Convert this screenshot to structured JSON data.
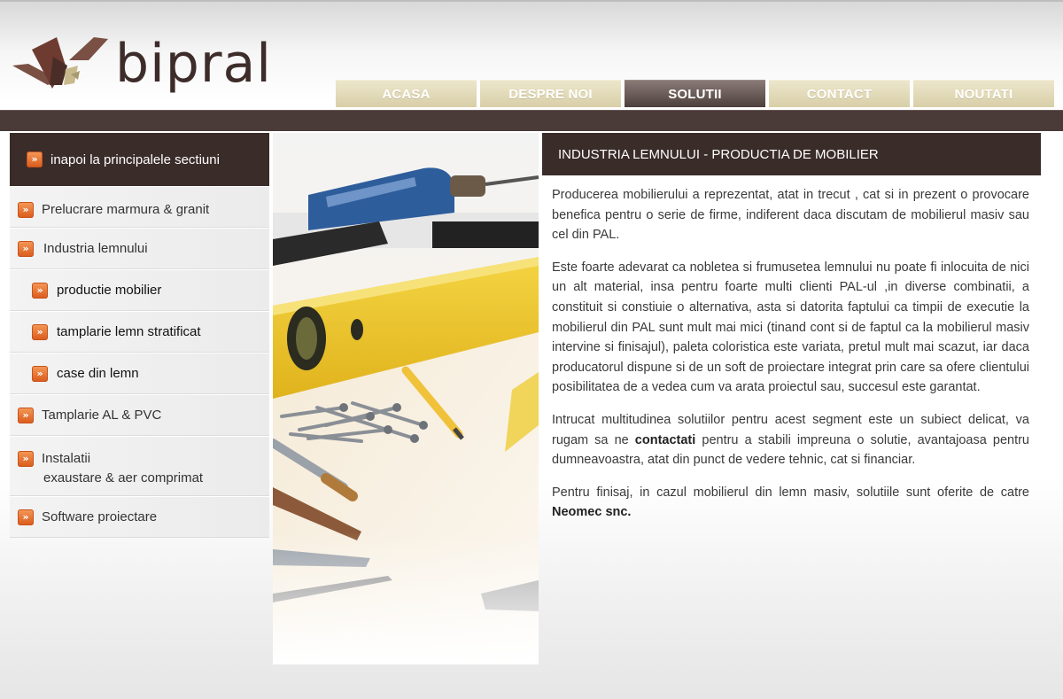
{
  "brand": {
    "name": "bipral"
  },
  "nav": {
    "items": [
      {
        "label": "ACASA"
      },
      {
        "label": "DESPRE NOI"
      },
      {
        "label": "SOLUTII"
      },
      {
        "label": "CONTACT"
      },
      {
        "label": "NOUTATI"
      }
    ],
    "active": "SOLUTII"
  },
  "sidebar": {
    "back_label": "inapoi la principalele sectiuni",
    "items": [
      {
        "label": "Prelucrare marmura & granit"
      },
      {
        "label": "Industria lemnului"
      },
      {
        "label": "productie mobilier"
      },
      {
        "label": "tamplarie lemn stratificat"
      },
      {
        "label": "case din lemn"
      },
      {
        "label": "Tamplarie AL & PVC"
      },
      {
        "label": "Instalatii",
        "label2": "exaustare & aer comprimat"
      },
      {
        "label": "Software proiectare"
      }
    ]
  },
  "content": {
    "title": "INDUSTRIA LEMNULUI - PRODUCTIA DE MOBILIER",
    "p1": "Producerea mobilierului a reprezentat, atat in trecut , cat si in prezent o provocare benefica pentru o serie de firme, indiferent daca discutam de mobilierul masiv sau cel din PAL.",
    "p2": "Este foarte adevarat ca nobletea si frumusetea lemnului nu poate fi inlocuita de nici un alt material, insa pentru foarte multi clienti PAL-ul ,in diverse combinatii, a constituit si constiuie o alternativa, asta si datorita faptului ca timpii de executie la mobilierul din PAL sunt mult mai mici (tinand cont si de faptul ca la mobilierul masiv intervine si finisajul), paleta coloristica este variata, pretul mult mai scazut, iar daca producatorul dispune si de un soft de proiectare integrat prin care sa ofere clientului posibilitatea de a vedea cum va arata proiectul sau, succesul este garantat.",
    "p3_before": "Intrucat multitudinea solutiilor pentru acest segment este un subiect delicat, va rugam sa ne ",
    "p3_link": "contactati",
    "p3_after": " pentru a stabili impreuna o solutie, avantajoasa pentru dumneavoastra, atat din punct de vedere tehnic, cat si financiar.",
    "p4_before": "Pentru finisaj, in cazul mobilierul din lemn masiv, solutiile sunt oferite de catre ",
    "p4_bold": "Neomec snc."
  },
  "colors": {
    "dark_brown": "#3a2c29",
    "nav_beige": "#e0d8b6",
    "accent_orange": "#e8652a"
  },
  "icons": {
    "bullet": "double-chevron-right-icon"
  }
}
